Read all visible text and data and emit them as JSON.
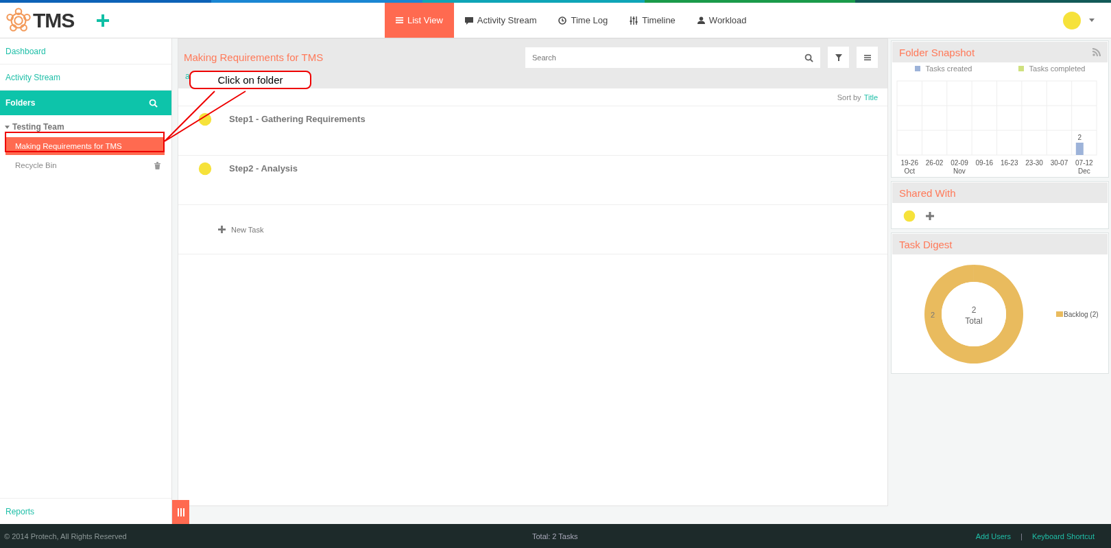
{
  "header": {
    "logo": "TMS",
    "nav": [
      {
        "label": "List View",
        "selected": true
      },
      {
        "label": "Activity Stream",
        "selected": false
      },
      {
        "label": "Time Log",
        "selected": false
      },
      {
        "label": "Timeline",
        "selected": false
      },
      {
        "label": "Workload",
        "selected": false
      }
    ]
  },
  "sidebar": {
    "items": [
      {
        "label": "Dashboard"
      },
      {
        "label": "Activity Stream"
      }
    ],
    "folders_title": "Folders",
    "tree": [
      {
        "label": "Testing Team",
        "expanded": true,
        "children": [
          {
            "label": "Making Requirements for TMS",
            "kind": "folder",
            "selected": true
          },
          {
            "label": "Recycle Bin",
            "kind": "trash",
            "selected": false
          }
        ]
      }
    ],
    "reports": "Reports"
  },
  "main": {
    "title": "Making Requirements for TMS",
    "breadcrumb": "a",
    "search": {
      "placeholder": "Search"
    },
    "sort_label": "Sort by",
    "sort_value": "Title",
    "tasks": [
      {
        "title": "Step1 - Gathering Requirements"
      },
      {
        "title": "Step2 - Analysis"
      }
    ],
    "new_task": "New Task"
  },
  "snapshot": {
    "title": "Folder Snapshot",
    "chart_data": {
      "type": "bar",
      "categories": [
        "19-26 Oct",
        "26-02",
        "02-09 Nov",
        "09-16",
        "16-23",
        "23-30",
        "30-07",
        "07-12 Dec"
      ],
      "series": [
        {
          "name": "Tasks created",
          "color": "#9db3d9",
          "values": [
            null,
            null,
            null,
            null,
            null,
            null,
            null,
            2
          ]
        },
        {
          "name": "Tasks completed",
          "color": "#cfe17f",
          "values": [
            null,
            null,
            null,
            null,
            null,
            null,
            null,
            null
          ]
        }
      ],
      "data_labels": true
    }
  },
  "shared": {
    "title": "Shared With"
  },
  "digest": {
    "title": "Task Digest",
    "chart_data": {
      "type": "donut",
      "categories": [
        "Backlog (2)"
      ],
      "series": [
        {
          "color": "#e9bb5e",
          "values": [
            2
          ]
        }
      ],
      "data_labels": true
    },
    "center_value": "2",
    "center_label": "Total"
  },
  "footer": {
    "copyright": "© 2014 Protech, All Rights Reserved",
    "total": "Total: 2 Tasks",
    "links": [
      "Add Users",
      "Keyboard Shortcut"
    ],
    "separator": "|"
  },
  "callout": {
    "text": "Click on folder"
  }
}
